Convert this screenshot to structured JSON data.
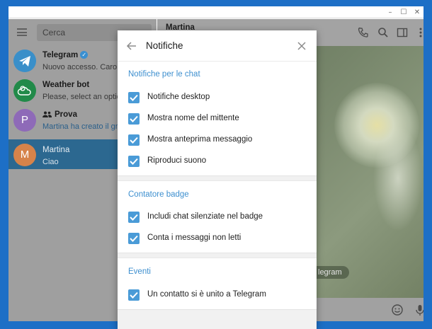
{
  "window": {
    "controls": [
      "–",
      "☐",
      "✕"
    ]
  },
  "sidebar": {
    "search_placeholder": "Cerca",
    "chats": [
      {
        "name": "Telegram",
        "preview": "Nuovo accesso. Caro Ma",
        "verified": true,
        "avatar_letter": "",
        "avatar_color": "#3a8fc9"
      },
      {
        "name": "Weather bot",
        "preview": "Please, select an option f",
        "verified": false,
        "avatar_letter": "",
        "avatar_color": "#218a49"
      },
      {
        "name": "Prova",
        "preview": "Martina ha creato il grup",
        "verified": false,
        "avatar_letter": "P",
        "avatar_color": "#8e6ab8",
        "is_group": true
      },
      {
        "name": "Martina",
        "preview": "Ciao",
        "verified": false,
        "avatar_letter": "M",
        "avatar_color": "#d6834a",
        "active": true
      }
    ]
  },
  "main": {
    "peer_name": "Martina",
    "service_message": "legram"
  },
  "dialog": {
    "title": "Notifiche",
    "sections": [
      {
        "title": "Notifiche per le chat",
        "options": [
          {
            "label": "Notifiche desktop",
            "checked": true
          },
          {
            "label": "Mostra nome del mittente",
            "checked": true
          },
          {
            "label": "Mostra anteprima messaggio",
            "checked": true
          },
          {
            "label": "Riproduci suono",
            "checked": true
          }
        ]
      },
      {
        "title": "Contatore badge",
        "options": [
          {
            "label": "Includi chat silenziate nel badge",
            "checked": true
          },
          {
            "label": "Conta i messaggi non letti",
            "checked": true
          }
        ]
      },
      {
        "title": "Eventi",
        "options": [
          {
            "label": "Un contatto si è unito a Telegram",
            "checked": true
          }
        ]
      }
    ]
  },
  "colors": {
    "accent": "#3d8fcf",
    "checkbox": "#4a9bd7",
    "desktop_bg": "#1d6fc6",
    "active_chat": "#2c6890"
  }
}
